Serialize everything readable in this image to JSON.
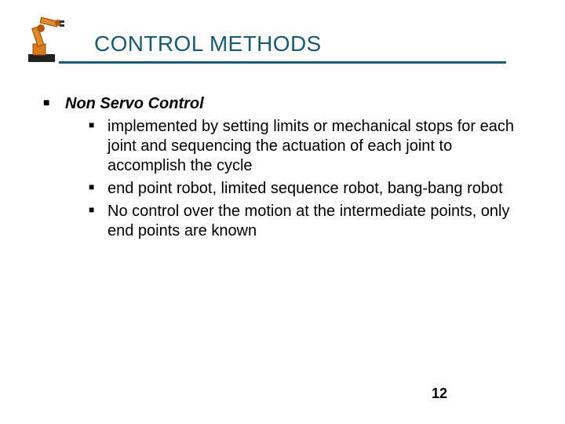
{
  "header": {
    "title": "CONTROL METHODS"
  },
  "content": {
    "heading": "Non Servo Control",
    "bullets": [
      "implemented by setting limits or mechanical stops for each joint and sequencing the actuation of each joint to accomplish the cycle",
      "end point robot, limited sequence robot, bang-bang robot",
      "No control over the motion at the intermediate points, only end points are known"
    ]
  },
  "footer": {
    "page_number": "12"
  },
  "icon": {
    "name": "robot-arm-icon"
  },
  "colors": {
    "accent": "#1a5b71"
  }
}
